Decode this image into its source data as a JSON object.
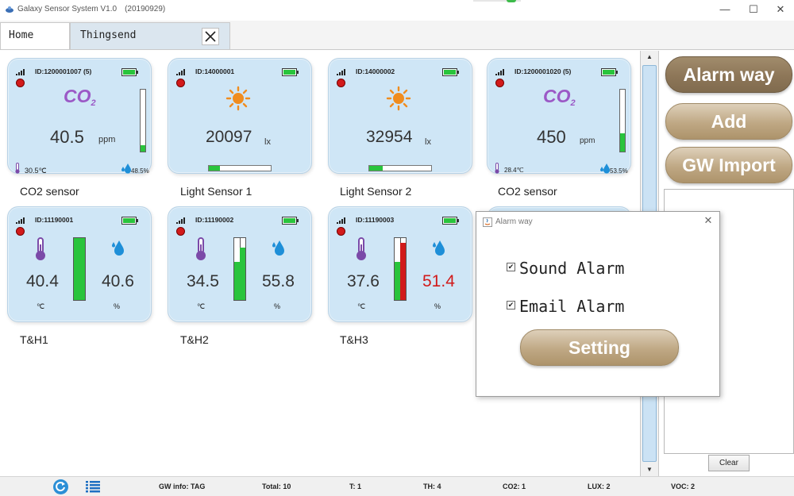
{
  "window": {
    "title": "Galaxy Sensor System V1.0",
    "build": "(20190929)",
    "minimize_glyph": "—",
    "maximize_glyph": "☐",
    "close_glyph": "✕",
    "icons": {
      "app": "satellite-app-icon"
    }
  },
  "tabs": [
    {
      "label": "Home",
      "active": false
    },
    {
      "label": "Thingsend",
      "active": true,
      "closable": true
    }
  ],
  "sensors": [
    {
      "id": "ID:1200001007  (5)",
      "kind": "co2",
      "co2_text": "CO",
      "co2_sub": "2",
      "value": "40.5",
      "unit": "ppm",
      "level": 0.1,
      "temp": "30.5℃",
      "humidity": "48.5%",
      "name": "CO2 sensor"
    },
    {
      "id": "ID:14000001",
      "kind": "light",
      "value": "20097",
      "unit": "lx",
      "level": 0.18,
      "name": "Light Sensor 1"
    },
    {
      "id": "ID:14000002",
      "kind": "light",
      "value": "32954",
      "unit": "lx",
      "level": 0.22,
      "name": "Light Sensor 2"
    },
    {
      "id": "ID:1200001020  (5)",
      "kind": "co2",
      "co2_text": "CO",
      "co2_sub": "2",
      "value": "450",
      "unit": "ppm",
      "level": 0.3,
      "temp": "28.4℃",
      "humidity": "53.5%",
      "name": "CO2 sensor"
    },
    {
      "id": "ID:11190001",
      "kind": "th",
      "temp": "40.4",
      "temp_unit": "℃",
      "humidity": "40.6",
      "hum_unit": "%",
      "temp_level": 1.0,
      "hum_level": 1.0,
      "hum_alarm": false,
      "name": "T&H1"
    },
    {
      "id": "ID:11190002",
      "kind": "th",
      "temp": "34.5",
      "temp_unit": "℃",
      "humidity": "55.8",
      "hum_unit": "%",
      "temp_level": 0.62,
      "hum_level": 0.85,
      "hum_alarm": false,
      "name": "T&H2"
    },
    {
      "id": "ID:11190003",
      "kind": "th",
      "temp": "37.6",
      "temp_unit": "℃",
      "humidity": "51.4",
      "hum_unit": "%",
      "temp_level": 0.62,
      "hum_level": 0.92,
      "hum_alarm": true,
      "name": "T&H3"
    }
  ],
  "colors": {
    "green": "#29c43c",
    "red": "#d11a1a",
    "card": "#cfe6f6",
    "co2": "#9b59c6",
    "sun": "#f08c1e",
    "drop": "#1e8fd8"
  },
  "right_panel": {
    "alarm_way_label": "Alarm way",
    "add_label": "Add",
    "gw_import_label": "GW Import",
    "clear_label": "Clear"
  },
  "dialog": {
    "title": "Alarm way",
    "close_glyph": "✕",
    "options": [
      {
        "label": "Sound Alarm",
        "checked": true
      },
      {
        "label": "Email Alarm",
        "checked": true
      }
    ],
    "setting_label": "Setting"
  },
  "statusbar": {
    "gw_info": "GW info: TAG",
    "total": "Total: 10",
    "t": "T:  1",
    "th": "TH:  4",
    "co2": "CO2:  1",
    "lux": "LUX:  2",
    "voc": "VOC:  2",
    "icons": {
      "refresh": "refresh-icon",
      "list": "list-icon"
    }
  },
  "scroll": {
    "up_glyph": "▲",
    "down_glyph": "▼"
  }
}
